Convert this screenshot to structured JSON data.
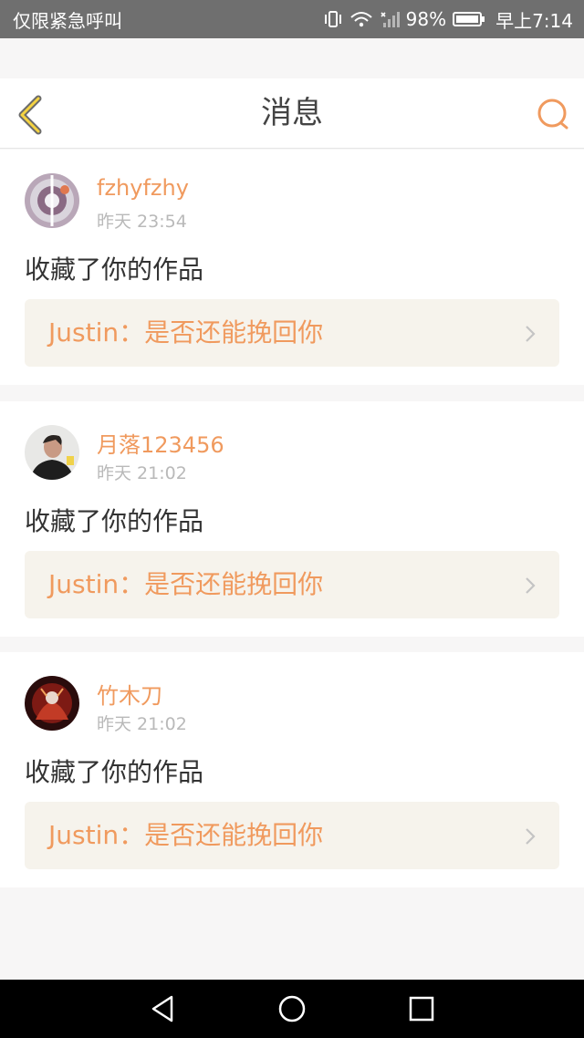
{
  "status_bar": {
    "left_text": "仅限紧急呼叫",
    "battery": "98%",
    "time": "早上7:14",
    "icons": [
      "vibrate-icon",
      "wifi-icon",
      "signal-icon",
      "battery-icon"
    ]
  },
  "header": {
    "title": "消息",
    "back_icon": "chevron-left-icon",
    "search_icon": "search-icon",
    "accent_color": "#f09a5e"
  },
  "messages": [
    {
      "username": "fzhyfzhy",
      "time": "昨天 23:54",
      "action": "收藏了你的作品",
      "work": "Justin：是否还能挽回你",
      "avatar": "avatar-fzhyfzhy"
    },
    {
      "username": "月落123456",
      "time": "昨天 21:02",
      "action": "收藏了你的作品",
      "work": "Justin：是否还能挽回你",
      "avatar": "avatar-yueluo"
    },
    {
      "username": "竹木刀",
      "time": "昨天 21:02",
      "action": "收藏了你的作品",
      "work": "Justin：是否还能挽回你",
      "avatar": "avatar-zhumudao"
    }
  ],
  "nav_bar": {
    "buttons": [
      "back-triangle-icon",
      "home-circle-icon",
      "recents-square-icon"
    ]
  }
}
